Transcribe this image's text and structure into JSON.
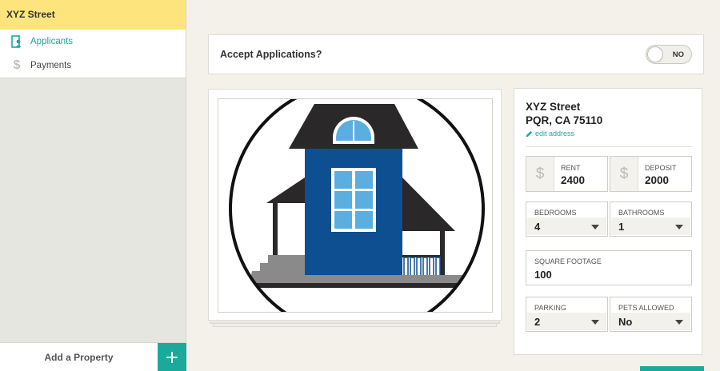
{
  "sidebar": {
    "property_name": "XYZ Street",
    "items": [
      {
        "label": "Applicants",
        "icon": "applicants-icon"
      },
      {
        "label": "Payments",
        "icon": "dollar-icon"
      }
    ],
    "footer": {
      "add_label": "Add a Property",
      "add_icon": "plus-icon"
    }
  },
  "accept": {
    "label": "Accept Applications?",
    "toggle_text": "NO"
  },
  "property": {
    "address_line1": "XYZ Street",
    "address_line2": "PQR, CA 75110",
    "edit_label": "edit address",
    "image_icon": "house-illustration"
  },
  "money": {
    "currency_symbol": "$",
    "rent_label": "RENT",
    "rent_value": "2400",
    "deposit_label": "DEPOSIT",
    "deposit_value": "2000"
  },
  "fields": {
    "bedrooms_label": "BEDROOMS",
    "bedrooms_value": "4",
    "bathrooms_label": "BATHROOMS",
    "bathrooms_value": "1",
    "sqft_label": "SQUARE FOOTAGE",
    "sqft_value": "100",
    "parking_label": "PARKING",
    "parking_value": "2",
    "pets_label": "PETS ALLOWED",
    "pets_value": "No"
  },
  "colors": {
    "accent": "#1ba99b",
    "header_yellow": "#fde47c",
    "house_blue": "#0e4f92"
  }
}
